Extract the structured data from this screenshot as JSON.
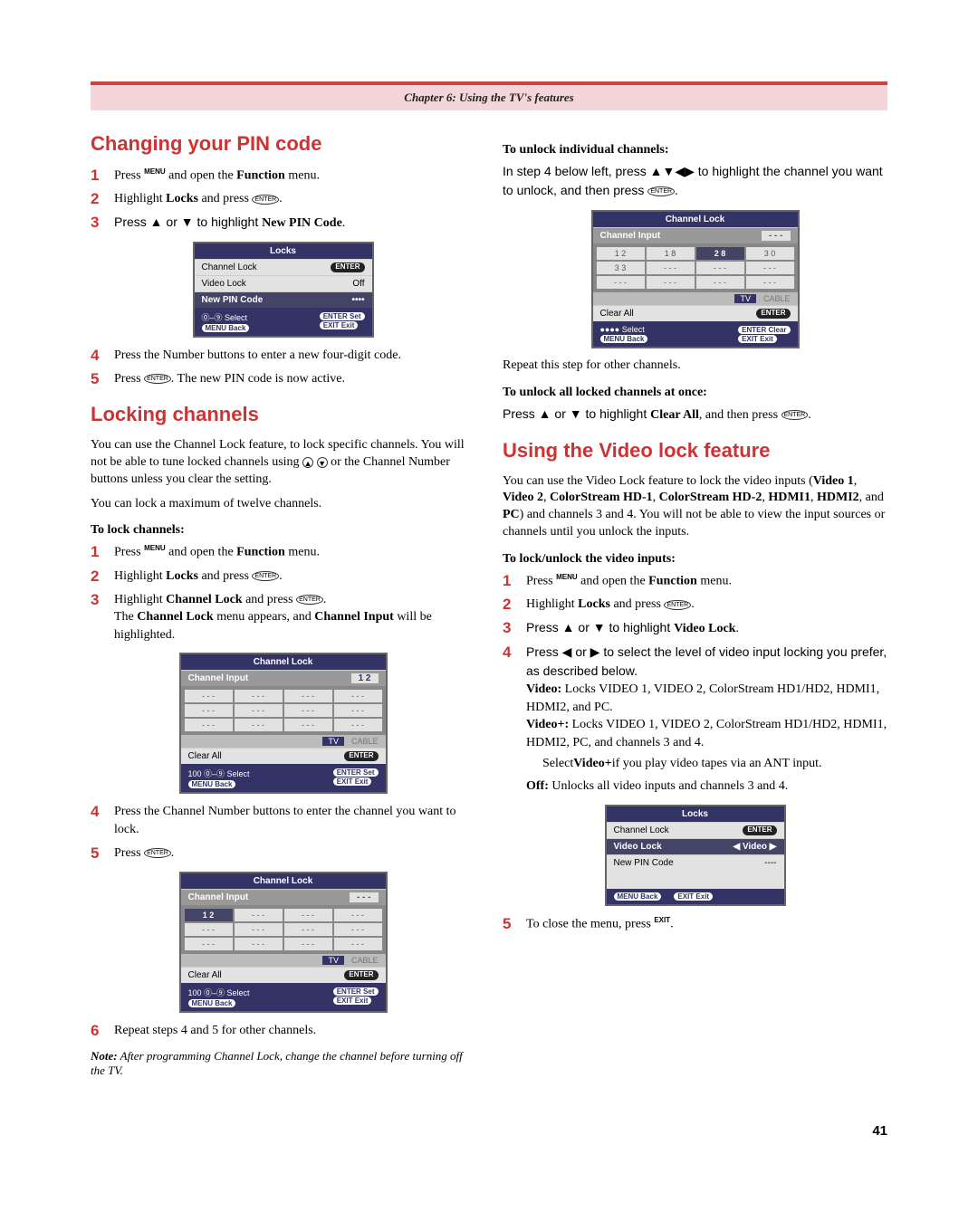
{
  "chapter_header": "Chapter 6: Using the TV's features",
  "left": {
    "h_change_pin": "Changing your PIN code",
    "steps_pin": {
      "s1": {
        "num": "1",
        "pre": "Press ",
        "sup": "MENU",
        "post": " and open the ",
        "bold": "Function",
        "end": " menu."
      },
      "s2": {
        "num": "2",
        "pre": "Highlight ",
        "bold": "Locks",
        "post": " and press ",
        "icon": "ENTER",
        "end": "."
      },
      "s3": {
        "num": "3",
        "pre": "Press ▲ or ▼ to highlight ",
        "bold": "New PIN Code",
        "end": "."
      },
      "s4": {
        "num": "4",
        "text": "Press the Number buttons to enter a new four-digit code."
      },
      "s5": {
        "num": "5",
        "pre": "Press ",
        "icon": "ENTER",
        "post": ". The new PIN code is now active."
      }
    },
    "osd_locks": {
      "title": "Locks",
      "r1_label": "Channel Lock",
      "r1_val": "ENTER",
      "r2_label": "Video Lock",
      "r2_val": "Off",
      "r3_label": "New PIN Code",
      "r3_val": "••••",
      "foot_l1": "⓪–⑨  Select",
      "foot_r1": "ENTER  Set",
      "foot_l2": "MENU  Back",
      "foot_r2": "EXIT  Exit"
    },
    "h_locking": "Locking channels",
    "lock_p1": "You can use the Channel Lock feature, to lock specific channels. You will not be able to tune locked channels using ",
    "lock_p1_mid": " or the Channel Number buttons unless you clear the setting.",
    "lock_p2": "You can lock a maximum of twelve channels.",
    "lock_sub": "To lock channels:",
    "steps_lock": {
      "s1": {
        "num": "1",
        "pre": "Press ",
        "sup": "MENU",
        "post": " and open the ",
        "bold": "Function",
        "end": " menu."
      },
      "s2": {
        "num": "2",
        "pre": "Highlight ",
        "bold": "Locks",
        "post": " and press ",
        "icon": "ENTER",
        "end": "."
      },
      "s3": {
        "num": "3",
        "pre": "Highlight ",
        "bold": "Channel Lock",
        "post": " and press ",
        "icon": "ENTER",
        "end": ".",
        "extra_a": "The ",
        "extra_b": "Channel Lock",
        "extra_c": " menu appears, and ",
        "extra_d": "Channel Input",
        "extra_e": " will be highlighted."
      },
      "s4": {
        "num": "4",
        "text": "Press the Channel Number buttons to enter the channel you want to lock."
      },
      "s5": {
        "num": "5",
        "pre": "Press ",
        "icon": "ENTER",
        "end": "."
      },
      "s6": {
        "num": "6",
        "text": "Repeat steps 4 and 5 for other channels."
      }
    },
    "osd_chlock1": {
      "title": "Channel Lock",
      "head_l": "Channel Input",
      "head_r": "1 2",
      "tv": "TV",
      "cable": "CABLE",
      "clear": "Clear All",
      "clear_val": "ENTER",
      "foot_l1": "100  ⓪–⑨ Select",
      "foot_r1": "ENTER  Set",
      "foot_l2": "MENU  Back",
      "foot_r2": "EXIT  Exit"
    },
    "osd_chlock2": {
      "title": "Channel Lock",
      "head_l": "Channel Input",
      "head_r": "- - -",
      "c1": "1 2",
      "tv": "TV",
      "cable": "CABLE",
      "clear": "Clear All",
      "clear_val": "ENTER",
      "foot_l1": "100  ⓪–⑨ Select",
      "foot_r1": "ENTER  Set",
      "foot_l2": "MENU  Back",
      "foot_r2": "EXIT  Exit"
    },
    "note": {
      "label": "Note:",
      "text": " After programming Channel Lock, change the channel before turning off the TV."
    }
  },
  "right": {
    "sub_unlock": "To unlock individual channels:",
    "unlock_p": "In step 4 below left, press ▲▼◀▶ to highlight the channel you want to unlock, and then press ",
    "unlock_end": ".",
    "osd_unlock": {
      "title": "Channel Lock",
      "head_l": "Channel Input",
      "head_r": "- - -",
      "c11": "1 2",
      "c12": "1 8",
      "c13": "2 8",
      "c14": "3 0",
      "c21": "3 3",
      "tv": "TV",
      "cable": "CABLE",
      "clear": "Clear All",
      "clear_val": "ENTER",
      "foot_l1": "●●●● Select",
      "foot_r1": "ENTER  Clear",
      "foot_l2": "MENU  Back",
      "foot_r2": "EXIT  Exit"
    },
    "repeat_text": "Repeat this step for other channels.",
    "sub_unlock_all": "To unlock all locked channels at once:",
    "unlock_all_p_a": "Press ▲ or ▼ to highlight ",
    "unlock_all_bold": "Clear All",
    "unlock_all_p_b": ", and then press ",
    "unlock_all_end": ".",
    "h_video": "Using the Video lock feature",
    "video_p_a": "You can use the Video Lock feature to lock the video inputs (",
    "video_b1": "Video 1",
    "video_c1": ", ",
    "video_b2": "Video 2",
    "video_c2": ", ",
    "video_b3": "ColorStream HD-1",
    "video_c3": ", ",
    "video_b4": "ColorStream HD-2",
    "video_c4": ", ",
    "video_b5": "HDMI1",
    "video_c5": ", ",
    "video_b6": "HDMI2",
    "video_c6": ", and ",
    "video_b7": "PC",
    "video_p_b": ") and channels 3 and 4. You will not be able to view the input sources or channels until you unlock the inputs.",
    "sub_video": "To lock/unlock the video inputs:",
    "steps_video": {
      "s1": {
        "num": "1",
        "pre": "Press ",
        "sup": "MENU",
        "post": " and open the ",
        "bold": "Function",
        "end": " menu."
      },
      "s2": {
        "num": "2",
        "pre": "Highlight ",
        "bold": "Locks",
        "post": " and press ",
        "icon": "ENTER",
        "end": "."
      },
      "s3": {
        "num": "3",
        "pre": "Press ▲ or ▼ to highlight ",
        "bold": "Video Lock",
        "end": "."
      },
      "s4": {
        "num": "4",
        "pre": "Press ◀ or ▶ to select the level of video input locking you prefer, as described below.",
        "video_l": "Video:",
        "video_t": " Locks VIDEO 1, VIDEO 2, ColorStream HD1/HD2, HDMI1, HDMI2, and PC.",
        "videop_l": "Video+:",
        "videop_t": " Locks VIDEO 1, VIDEO 2, ColorStream HD1/HD2, HDMI1, HDMI2, PC, and channels 3 and 4.",
        "bullet_a": "Select ",
        "bullet_b": "Video+",
        "bullet_c": " if you play video tapes via an ANT input.",
        "off_l": "Off:",
        "off_t": " Unlocks all video inputs and channels 3 and 4."
      },
      "s5": {
        "num": "5",
        "pre": "To close the menu, press ",
        "sup": "EXIT",
        "end": "."
      }
    },
    "osd_video": {
      "title": "Locks",
      "r1_label": "Channel Lock",
      "r1_val": "ENTER",
      "r2_label": "Video Lock",
      "r2_val": "Video",
      "r3_label": "New PIN Code",
      "r3_val": "----",
      "foot_l": "MENU  Back",
      "foot_r": "EXIT  Exit"
    }
  },
  "page_num": "41"
}
